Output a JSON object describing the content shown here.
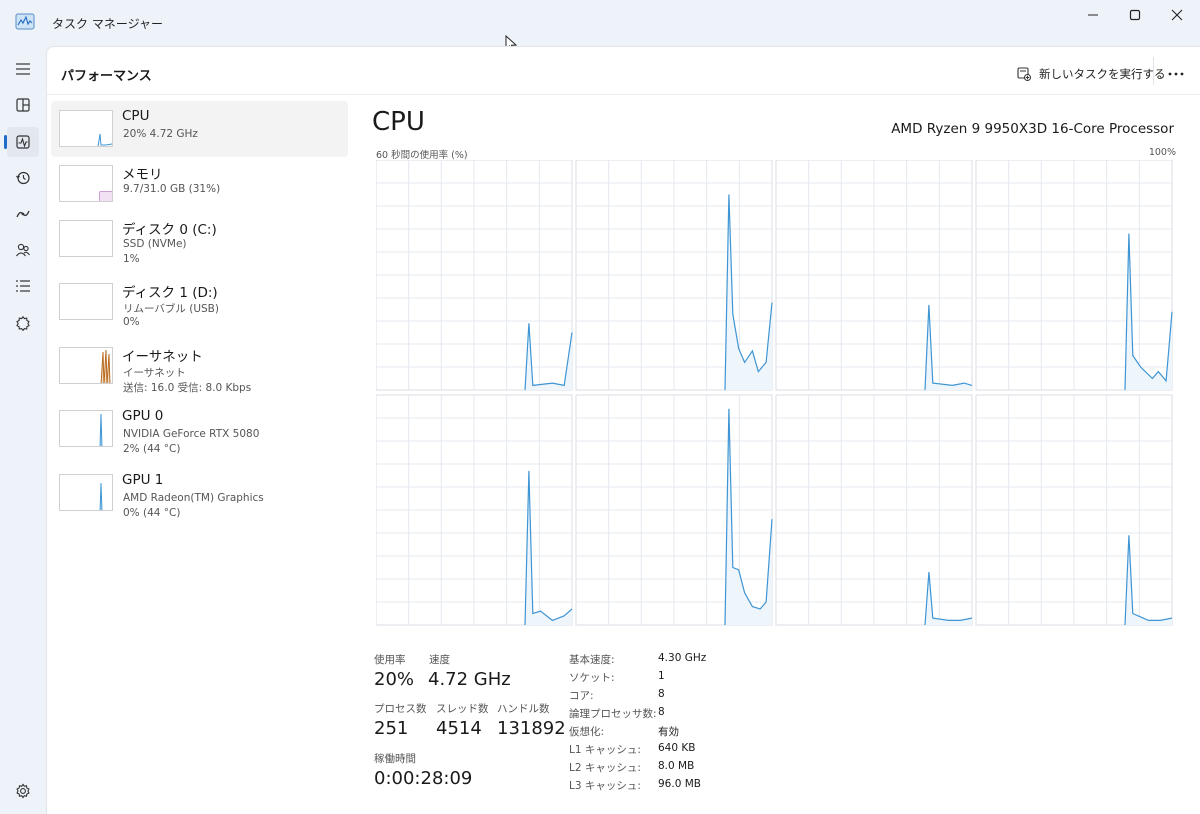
{
  "window": {
    "title": "タスク マネージャー"
  },
  "header": {
    "title": "パフォーマンス",
    "run_task_label": "新しいタスクを実行する",
    "more_label": "..."
  },
  "rail": {
    "items": [
      {
        "icon": "hamburger-menu-icon"
      },
      {
        "icon": "processes-icon"
      },
      {
        "icon": "performance-icon",
        "active": true
      },
      {
        "icon": "app-history-icon"
      },
      {
        "icon": "startup-apps-icon"
      },
      {
        "icon": "users-icon"
      },
      {
        "icon": "details-icon"
      },
      {
        "icon": "services-icon"
      }
    ],
    "settings_icon": "settings-gear-icon"
  },
  "devices": [
    {
      "name": "CPU",
      "sub1": "20%  4.72 GHz",
      "sub2": "",
      "selected": true,
      "color": "#3f95d4"
    },
    {
      "name": "メモリ",
      "sub1": "9.7/31.0 GB (31%)",
      "sub2": "",
      "color": "#9c3fa8"
    },
    {
      "name": "ディスク 0 (C:)",
      "sub1": "SSD (NVMe)",
      "sub2": "1%",
      "color": "#4fa84f"
    },
    {
      "name": "ディスク 1 (D:)",
      "sub1": "リムーバブル (USB)",
      "sub2": "0%",
      "color": "#4fa84f"
    },
    {
      "name": "イーサネット",
      "sub1": "イーサネット",
      "sub2": "送信: 16.0  受信: 8.0 Kbps",
      "color": "#b86a1e"
    },
    {
      "name": "GPU 0",
      "sub1": "NVIDIA GeForce RTX 5080",
      "sub2": "2% (44 °C)",
      "color": "#3f95d4"
    },
    {
      "name": "GPU 1",
      "sub1": "AMD Radeon(TM) Graphics",
      "sub2": "0% (44 °C)",
      "color": "#3f95d4"
    }
  ],
  "cpu": {
    "title": "CPU",
    "model": "AMD Ryzen 9 9950X3D 16-Core Processor",
    "graph_caption": "60 秒間の使用率 (%)",
    "graph_max": "100%",
    "stats": {
      "usage_label": "使用率",
      "usage_value": "20%",
      "speed_label": "速度",
      "speed_value": "4.72 GHz",
      "processes_label": "プロセス数",
      "processes_value": "251",
      "threads_label": "スレッド数",
      "threads_value": "4514",
      "handles_label": "ハンドル数",
      "handles_value": "131892",
      "uptime_label": "稼働時間",
      "uptime_value": "0:00:28:09"
    },
    "specs": [
      {
        "label": "基本速度:",
        "value": "4.30 GHz"
      },
      {
        "label": "ソケット:",
        "value": "1"
      },
      {
        "label": "コア:",
        "value": "8"
      },
      {
        "label": "論理プロセッサ数:",
        "value": "8"
      },
      {
        "label": "仮想化:",
        "value": "有効"
      },
      {
        "label": "L1 キャッシュ:",
        "value": "640 KB"
      },
      {
        "label": "L2 キャッシュ:",
        "value": "8.0 MB"
      },
      {
        "label": "L3 キャッシュ:",
        "value": "96.0 MB"
      }
    ]
  },
  "colors": {
    "accent": "#1f6fc8",
    "cpu_line": "#3f95d4",
    "grid": "#e4e9ef"
  }
}
